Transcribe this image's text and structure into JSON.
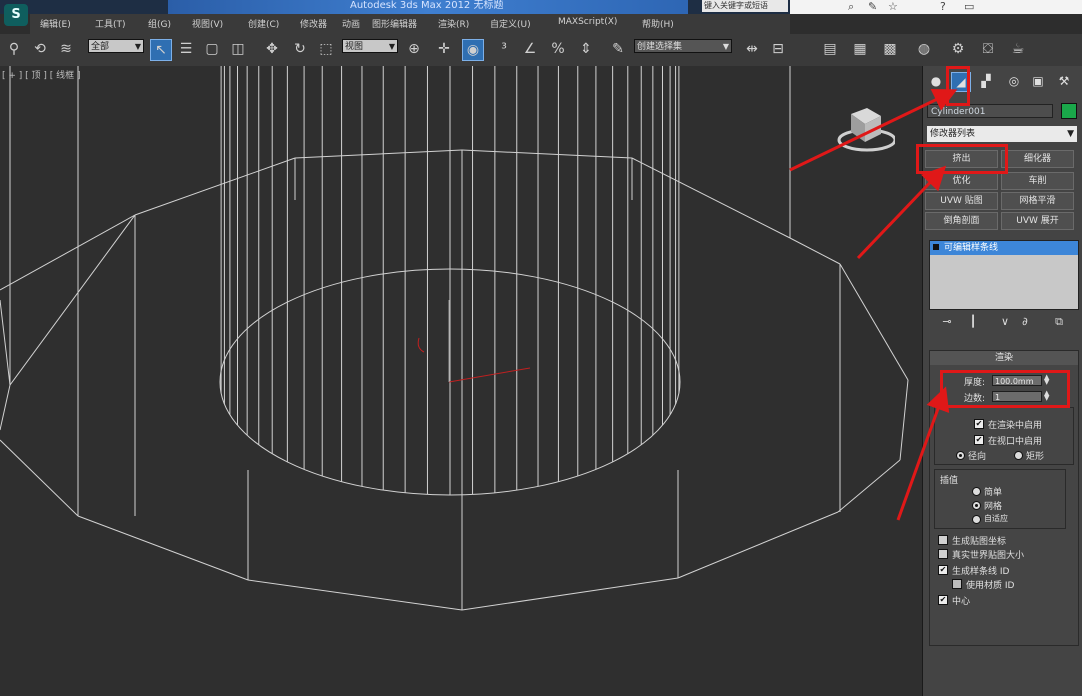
{
  "app": {
    "logo": "S",
    "title": "Autodesk 3ds Max 2012 无标题",
    "search_placeholder": "键入关键字或短语"
  },
  "menu": [
    "编辑(E)",
    "工具(T)",
    "组(G)",
    "视图(V)",
    "创建(C)",
    "修改器",
    "动画",
    "图形编辑器",
    "渲染(R)",
    "自定义(U)",
    "MAXScript(X)",
    "帮助(H)"
  ],
  "toolbar": {
    "selection_filter": "全部",
    "coord_system": "视图",
    "named_selection": "创建选择集"
  },
  "viewport": {
    "label": "[ + ] [ 顶 ] [ 线框 ]"
  },
  "command_panel": {
    "object_name": "Cylinder001",
    "modifier_list": "修改器列表",
    "buttons": [
      "挤出",
      "细化器",
      "优化",
      "车削",
      "UVW 贴图",
      "网格平滑",
      "倒角剖面",
      "UVW 展开"
    ],
    "stack_item": "可编辑样条线",
    "rollout": {
      "title": "渲染",
      "thickness_label": "厚度:",
      "thickness_value": "100.0mm",
      "sides_label": "边数:",
      "sides_value": "1",
      "enable_in_renderer": "在渲染中启用",
      "enable_in_viewport": "在视口中启用",
      "radio_radial": "径向",
      "radio_rect": "矩形",
      "interp_title": "插值",
      "interp_options": [
        "简单",
        "网格",
        "自适应"
      ],
      "gen_mapping": "生成贴图坐标",
      "real_world": "真实世界贴图大小",
      "auto_smooth": "生成样条线 ID",
      "use_mat_id": "使用材质 ID",
      "flip": "中心"
    }
  },
  "colors": {
    "annotation_red": "#e01818",
    "active_tab": "#2f6fb2",
    "object_color": "#1aa84a"
  }
}
